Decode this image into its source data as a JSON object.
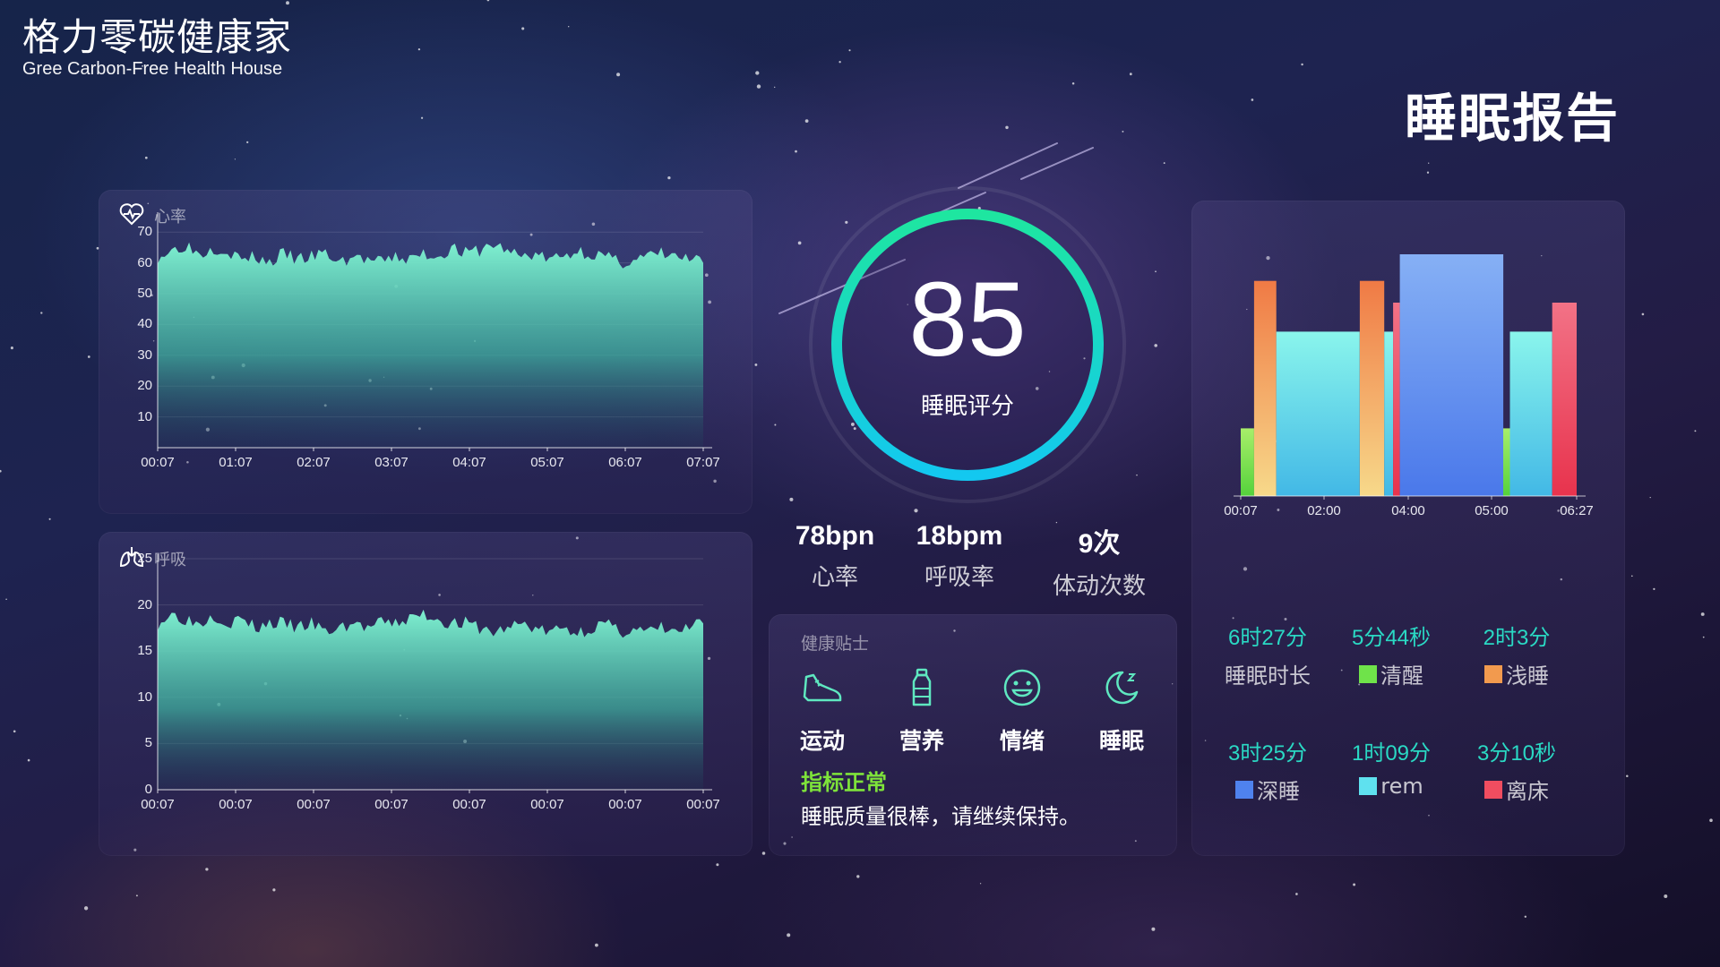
{
  "brand": {
    "title_cn": "格力零碳健康家",
    "title_en": "Gree Carbon-Free Health House"
  },
  "page_title": "睡眠报告",
  "heart_rate_panel": {
    "title": "心率",
    "icon": "heart-pulse-icon",
    "chart_data": {
      "type": "area",
      "ylim": [
        0,
        75
      ],
      "y_ticks": [
        "70",
        "60",
        "50",
        "40",
        "30",
        "20",
        "10"
      ],
      "x_ticks": [
        "00:07",
        "01:07",
        "02:07",
        "03:07",
        "04:07",
        "05:07",
        "06:07",
        "07:07"
      ],
      "series": [
        {
          "values": [
            62,
            64,
            66,
            63,
            65,
            64,
            61,
            62,
            60,
            63,
            61,
            62,
            63,
            60,
            62,
            61,
            60,
            62,
            61,
            63,
            62,
            65,
            63,
            64,
            66,
            64,
            62,
            63,
            61,
            62,
            64,
            63,
            62,
            60,
            61,
            62,
            63,
            62,
            61,
            60
          ]
        }
      ]
    }
  },
  "breath_panel": {
    "title": "呼吸",
    "icon": "lungs-icon",
    "chart_data": {
      "type": "area",
      "ylim": [
        0,
        25
      ],
      "y_ticks": [
        "25",
        "20",
        "15",
        "10",
        "5",
        "0"
      ],
      "x_ticks": [
        "00:07",
        "00:07",
        "00:07",
        "00:07",
        "00:07",
        "00:07",
        "00:07",
        "00:07"
      ],
      "series": [
        {
          "values": [
            18,
            19,
            18.5,
            18,
            19,
            18,
            18.5,
            17.5,
            18,
            18,
            17.5,
            18,
            17,
            17.5,
            18,
            17.5,
            18,
            18,
            18.5,
            19,
            18.5,
            18,
            18,
            17.5,
            17,
            17.5,
            18,
            17.5,
            17,
            17.5,
            17,
            17.5,
            18,
            17,
            17.5,
            17,
            17.5,
            17,
            17.5,
            18
          ]
        }
      ]
    }
  },
  "score": {
    "value": "85",
    "label": "睡眠评分",
    "fraction": 0.85
  },
  "stats": [
    {
      "value": "78bpn",
      "label": "心率"
    },
    {
      "value": "18bpm",
      "label": "呼吸率"
    },
    {
      "value": "9次",
      "label": "体动次数"
    }
  ],
  "tips": {
    "title": "健康贴士",
    "items": [
      {
        "label": "运动",
        "icon": "sneaker-icon"
      },
      {
        "label": "营养",
        "icon": "bottle-icon"
      },
      {
        "label": "情绪",
        "icon": "smile-icon"
      },
      {
        "label": "睡眠",
        "icon": "moon-zz-icon"
      }
    ],
    "status": "指标正常",
    "message": "睡眠质量很棒，请继续保持。"
  },
  "stages_panel": {
    "chart_data": {
      "type": "bar",
      "x_ticks": [
        "00:07",
        "02:00",
        "04:00",
        "05:00",
        "06:27"
      ],
      "stages": [
        {
          "stage": "清醒",
          "level": 0.28
        },
        {
          "stage": "浅睡",
          "level": 0.89
        },
        {
          "stage": "rem",
          "level": 0.68
        },
        {
          "stage": "浅睡",
          "level": 0.89
        },
        {
          "stage": "rem",
          "level": 0.68
        },
        {
          "stage": "离床",
          "level": 0.8
        },
        {
          "stage": "深睡",
          "level": 1.0
        },
        {
          "stage": "清醒",
          "level": 0.28
        },
        {
          "stage": "rem",
          "level": 0.68
        },
        {
          "stage": "离床",
          "level": 0.8
        }
      ]
    },
    "legend": [
      {
        "value": "6时27分",
        "label": "睡眠时长",
        "color": ""
      },
      {
        "value": "5分44秒",
        "label": "清醒",
        "color": "#6fe34a"
      },
      {
        "value": "2时3分",
        "label": "浅睡",
        "color": "#f29a4e"
      },
      {
        "value": "3时25分",
        "label": "深睡",
        "color": "#4f82ee"
      },
      {
        "value": "1时09分",
        "label": "rem",
        "color": "#5fe1ef"
      },
      {
        "value": "3分10秒",
        "label": "离床",
        "color": "#f04d60"
      }
    ]
  }
}
